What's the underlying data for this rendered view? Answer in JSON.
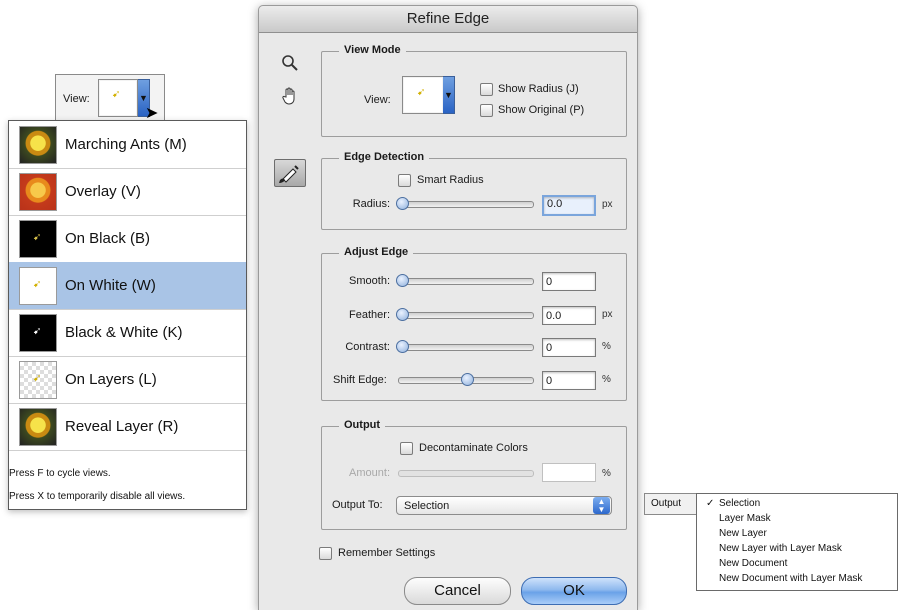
{
  "dialog": {
    "title": "Refine Edge",
    "view_mode": {
      "legend": "View Mode",
      "view_label": "View:",
      "show_radius": "Show Radius (J)",
      "show_original": "Show Original (P)"
    },
    "edge_detection": {
      "legend": "Edge Detection",
      "smart_radius": "Smart Radius",
      "radius_label": "Radius:",
      "radius_value": "0.0",
      "radius_unit": "px"
    },
    "adjust_edge": {
      "legend": "Adjust Edge",
      "smooth_label": "Smooth:",
      "smooth_value": "0",
      "feather_label": "Feather:",
      "feather_value": "0.0",
      "feather_unit": "px",
      "contrast_label": "Contrast:",
      "contrast_value": "0",
      "contrast_unit": "%",
      "shift_label": "Shift Edge:",
      "shift_value": "0",
      "shift_unit": "%"
    },
    "output": {
      "legend": "Output",
      "decontaminate": "Decontaminate Colors",
      "amount_label": "Amount:",
      "amount_value": "",
      "amount_unit": "%",
      "output_to_label": "Output To:",
      "output_to_value": "Selection"
    },
    "remember": "Remember Settings",
    "cancel": "Cancel",
    "ok": "OK"
  },
  "view_popup": {
    "view_label": "View:",
    "items": [
      {
        "label": "Marching Ants (M)",
        "thumb": "flower"
      },
      {
        "label": "Overlay (V)",
        "thumb": "flower-red"
      },
      {
        "label": "On Black (B)",
        "thumb": "black"
      },
      {
        "label": "On White (W)",
        "thumb": "white",
        "selected": true
      },
      {
        "label": "Black & White (K)",
        "thumb": "black-white"
      },
      {
        "label": "On Layers (L)",
        "thumb": "checker"
      },
      {
        "label": "Reveal Layer (R)",
        "thumb": "flower"
      }
    ],
    "note1": "Press F to cycle views.",
    "note2": "Press X to temporarily disable all views."
  },
  "output_popup": {
    "label": "Output",
    "checkmark": "✓",
    "options": [
      "Selection",
      "Layer Mask",
      "New Layer",
      "New Layer with Layer Mask",
      "New Document",
      "New Document with Layer Mask"
    ]
  },
  "colors": {
    "selection_highlight": "#a9c4e6",
    "accent_blue": "#2c68cc",
    "dialog_bg": "#e9e9e9"
  },
  "icons": {
    "zoom": "magnifier-icon",
    "hand": "hand-icon",
    "refine_brush": "refine-radius-brush-icon"
  }
}
